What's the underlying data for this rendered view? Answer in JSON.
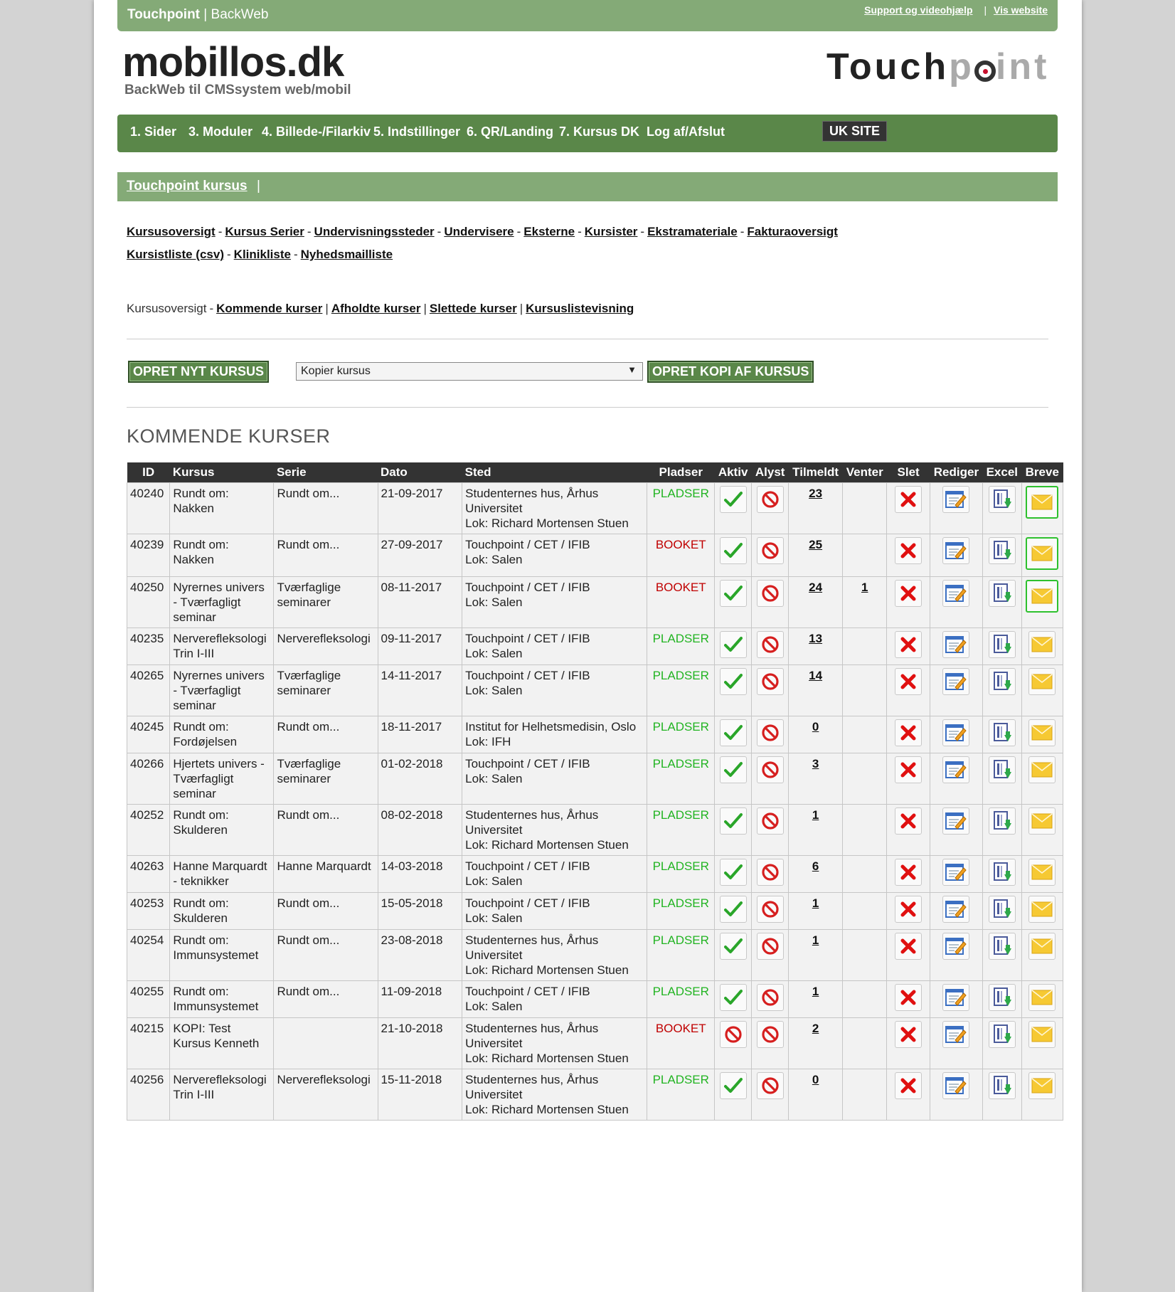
{
  "topbar": {
    "brand_bold": "Touchpoint",
    "brand_sep": " | ",
    "brand_rest": "BackWeb",
    "links": [
      "Support og videohjælp",
      "Vis website"
    ]
  },
  "logo": {
    "main": "mobillos.dk",
    "sub": "BackWeb til CMSsystem web/mobil",
    "right_a": "Touch",
    "right_b": "p",
    "right_c": "int"
  },
  "main_nav": [
    "1. Sider",
    "3. Moduler",
    "4. Billede-/Filarkiv",
    "5. Indstillinger",
    "6. QR/Landing",
    "7. Kursus DK",
    "Log af/Afslut"
  ],
  "uk_site": "UK SITE",
  "subbar": {
    "link": "Touchpoint kursus",
    "pipe": "|"
  },
  "sublinks_row1": [
    "Kursusoversigt",
    "Kursus Serier",
    "Undervisningssteder",
    "Undervisere",
    "Eksterne",
    "Kursister",
    "Ekstramateriale",
    "Fakturaoversigt"
  ],
  "sublinks_row2": [
    "Kursistliste (csv)",
    "Klinikliste",
    "Nyhedsmailliste"
  ],
  "crumbs": {
    "current": "Kursusoversigt",
    "links": [
      "Kommende kurser",
      "Afholdte kurser",
      "Slettede kurser",
      "Kursuslistevisning"
    ]
  },
  "actions": {
    "create": "OPRET NYT KURSUS",
    "copy_select": "Kopier kursus",
    "copy_button": "OPRET KOPI AF KURSUS"
  },
  "section_title": "KOMMENDE KURSER",
  "table": {
    "headers": [
      "ID",
      "Kursus",
      "Serie",
      "Dato",
      "Sted",
      "Pladser",
      "Aktiv",
      "Alyst",
      "Tilmeldt",
      "Venter",
      "Slet",
      "Rediger",
      "Excel",
      "Breve"
    ],
    "rows": [
      {
        "id": "40240",
        "kursus": "Rundt om: Nakken",
        "serie": "Rundt om...",
        "dato": "21-09-2017",
        "sted": "Studenternes hus, Århus Universitet",
        "lok": "Lok: Richard Mortensen Stuen",
        "pladser": "PLADSER",
        "aktiv": true,
        "tilmeldt": "23",
        "venter": "",
        "breve_hl": true
      },
      {
        "id": "40239",
        "kursus": "Rundt om: Nakken",
        "serie": "Rundt om...",
        "dato": "27-09-2017",
        "sted": "Touchpoint / CET / IFIB",
        "lok": "Lok: Salen",
        "pladser": "BOOKET",
        "aktiv": true,
        "tilmeldt": "25",
        "venter": "",
        "breve_hl": true
      },
      {
        "id": "40250",
        "kursus": "Nyrernes univers - Tværfagligt seminar",
        "serie": "Tværfaglige seminarer",
        "dato": "08-11-2017",
        "sted": "Touchpoint / CET / IFIB",
        "lok": "Lok: Salen",
        "pladser": "BOOKET",
        "aktiv": true,
        "tilmeldt": "24",
        "venter": "1",
        "breve_hl": true
      },
      {
        "id": "40235",
        "kursus": "Nerverefleksologi Trin I-III",
        "serie": "Nerverefleksologi",
        "dato": "09-11-2017",
        "sted": "Touchpoint / CET / IFIB",
        "lok": "Lok: Salen",
        "pladser": "PLADSER",
        "aktiv": true,
        "tilmeldt": "13",
        "venter": "",
        "breve_hl": false
      },
      {
        "id": "40265",
        "kursus": "Nyrernes univers - Tværfagligt seminar",
        "serie": "Tværfaglige seminarer",
        "dato": "14-11-2017",
        "sted": "Touchpoint / CET / IFIB",
        "lok": "Lok: Salen",
        "pladser": "PLADSER",
        "aktiv": true,
        "tilmeldt": "14",
        "venter": "",
        "breve_hl": false
      },
      {
        "id": "40245",
        "kursus": "Rundt om: Fordøjelsen",
        "serie": "Rundt om...",
        "dato": "18-11-2017",
        "sted": "Institut for Helhetsmedisin, Oslo",
        "lok": "Lok: IFH",
        "pladser": "PLADSER",
        "aktiv": true,
        "tilmeldt": "0",
        "venter": "",
        "breve_hl": false
      },
      {
        "id": "40266",
        "kursus": "Hjertets univers - Tværfagligt seminar",
        "serie": "Tværfaglige seminarer",
        "dato": "01-02-2018",
        "sted": "Touchpoint / CET / IFIB",
        "lok": "Lok: Salen",
        "pladser": "PLADSER",
        "aktiv": true,
        "tilmeldt": "3",
        "venter": "",
        "breve_hl": false
      },
      {
        "id": "40252",
        "kursus": "Rundt om: Skulderen",
        "serie": "Rundt om...",
        "dato": "08-02-2018",
        "sted": "Studenternes hus, Århus Universitet",
        "lok": "Lok: Richard Mortensen Stuen",
        "pladser": "PLADSER",
        "aktiv": true,
        "tilmeldt": "1",
        "venter": "",
        "breve_hl": false
      },
      {
        "id": "40263",
        "kursus": "Hanne Marquardt - teknikker",
        "serie": "Hanne Marquardt",
        "dato": "14-03-2018",
        "sted": "Touchpoint / CET / IFIB",
        "lok": "Lok: Salen",
        "pladser": "PLADSER",
        "aktiv": true,
        "tilmeldt": "6",
        "venter": "",
        "breve_hl": false
      },
      {
        "id": "40253",
        "kursus": "Rundt om: Skulderen",
        "serie": "Rundt om...",
        "dato": "15-05-2018",
        "sted": "Touchpoint / CET / IFIB",
        "lok": "Lok: Salen",
        "pladser": "PLADSER",
        "aktiv": true,
        "tilmeldt": "1",
        "venter": "",
        "breve_hl": false
      },
      {
        "id": "40254",
        "kursus": "Rundt om: Immunsystemet",
        "serie": "Rundt om...",
        "dato": "23-08-2018",
        "sted": "Studenternes hus, Århus Universitet",
        "lok": "Lok: Richard Mortensen Stuen",
        "pladser": "PLADSER",
        "aktiv": true,
        "tilmeldt": "1",
        "venter": "",
        "breve_hl": false
      },
      {
        "id": "40255",
        "kursus": "Rundt om: Immunsystemet",
        "serie": "Rundt om...",
        "dato": "11-09-2018",
        "sted": "Touchpoint / CET / IFIB",
        "lok": "Lok: Salen",
        "pladser": "PLADSER",
        "aktiv": true,
        "tilmeldt": "1",
        "venter": "",
        "breve_hl": false
      },
      {
        "id": "40215",
        "kursus": "KOPI: Test Kursus Kenneth",
        "serie": "",
        "dato": "21-10-2018",
        "sted": "Studenternes hus, Århus Universitet",
        "lok": "Lok: Richard Mortensen Stuen",
        "pladser": "BOOKET",
        "aktiv": false,
        "tilmeldt": "2",
        "venter": "",
        "breve_hl": false
      },
      {
        "id": "40256",
        "kursus": "Nerverefleksologi Trin I-III",
        "serie": "Nerverefleksologi",
        "dato": "15-11-2018",
        "sted": "Studenternes hus, Århus Universitet",
        "lok": "Lok: Richard Mortensen Stuen",
        "pladser": "PLADSER",
        "aktiv": true,
        "tilmeldt": "0",
        "venter": "",
        "breve_hl": false
      }
    ]
  },
  "colors": {
    "topbar": "#84aa77",
    "nav": "#5a8749",
    "status_green": "#22b422",
    "status_red": "#c00000"
  }
}
